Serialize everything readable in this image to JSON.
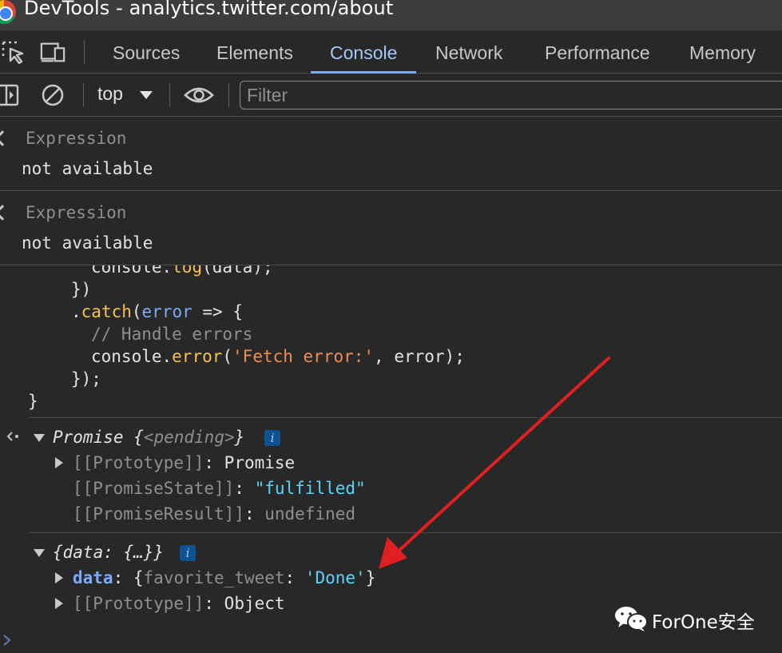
{
  "window": {
    "title": "DevTools - analytics.twitter.com/about"
  },
  "tabs": [
    {
      "label": "Sources"
    },
    {
      "label": "Elements"
    },
    {
      "label": "Console",
      "active": true
    },
    {
      "label": "Network"
    },
    {
      "label": "Performance"
    },
    {
      "label": "Memory"
    }
  ],
  "toolbar": {
    "context": "top",
    "filter_placeholder": "Filter"
  },
  "live_expressions": [
    {
      "label": "Expression",
      "value": "not available"
    },
    {
      "label": "Expression",
      "value": "not available"
    }
  ],
  "code": {
    "line1_a": "console.",
    "line1_b": "log",
    "line1_c": "(data);",
    "line2": "})",
    "line3_a": ".",
    "line3_b": "catch",
    "line3_c": "(",
    "line3_d": "error",
    "line3_e": " => {",
    "line4": "// Handle errors",
    "line5_a": "console.",
    "line5_b": "error",
    "line5_c": "(",
    "line5_d": "'Fetch error:'",
    "line5_e": ", error);",
    "line6": "});",
    "line7": "}"
  },
  "result1": {
    "name": "Promise",
    "brace_open": " {",
    "state_inline": "<pending>",
    "brace_close": "}",
    "badge": "i",
    "props": [
      {
        "key": "[[Prototype]]",
        "sep": ": ",
        "value": "Promise"
      },
      {
        "key": "[[PromiseState]]",
        "sep": ": ",
        "value": "\"fulfilled\""
      },
      {
        "key": "[[PromiseResult]]",
        "sep": ": ",
        "value": "undefined"
      }
    ]
  },
  "result2": {
    "preview": "{data: {…}}",
    "badge": "i",
    "data_key": "data",
    "data_sep": ": ",
    "data_open": "{",
    "data_inner_key": "favorite_tweet",
    "data_inner_sep": ": ",
    "data_inner_value": "'Done'",
    "data_close": "}",
    "proto_key": "[[Prototype]]",
    "proto_sep": ": ",
    "proto_value": "Object"
  },
  "watermark": {
    "text": "ForOne安全"
  },
  "colors": {
    "accent": "#a8c7fa",
    "arrow": "#e02020",
    "background": "#282828"
  }
}
